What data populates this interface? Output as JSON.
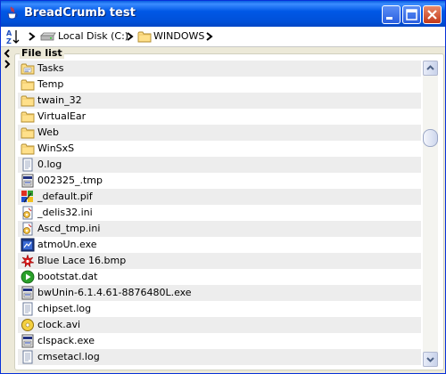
{
  "window": {
    "title": "BreadCrumb test"
  },
  "breadcrumb": {
    "items": [
      {
        "label": "Local Disk (C:)",
        "icon": "hard-drive-icon"
      },
      {
        "label": "WINDOWS",
        "icon": "folder-icon"
      }
    ]
  },
  "file_list": {
    "title": "File list",
    "items": [
      {
        "name": "Tasks",
        "icon": "tasks-folder-icon"
      },
      {
        "name": "Temp",
        "icon": "folder-icon"
      },
      {
        "name": "twain_32",
        "icon": "folder-icon"
      },
      {
        "name": "VirtualEar",
        "icon": "folder-icon"
      },
      {
        "name": "Web",
        "icon": "folder-icon"
      },
      {
        "name": "WinSxS",
        "icon": "folder-icon"
      },
      {
        "name": "0.log",
        "icon": "text-file-icon"
      },
      {
        "name": "002325_.tmp",
        "icon": "tmp-file-icon"
      },
      {
        "name": "_default.pif",
        "icon": "pif-file-icon"
      },
      {
        "name": "_delis32.ini",
        "icon": "ini-file-icon"
      },
      {
        "name": "Ascd_tmp.ini",
        "icon": "ini-file-icon"
      },
      {
        "name": "atmoUn.exe",
        "icon": "exe-file-icon"
      },
      {
        "name": "Blue Lace 16.bmp",
        "icon": "bmp-file-icon"
      },
      {
        "name": "bootstat.dat",
        "icon": "dat-file-icon"
      },
      {
        "name": "bwUnin-6.1.4.61-8876480L.exe",
        "icon": "tmp-file-icon"
      },
      {
        "name": "chipset.log",
        "icon": "text-file-icon"
      },
      {
        "name": "clock.avi",
        "icon": "avi-file-icon"
      },
      {
        "name": "clspack.exe",
        "icon": "tmp-file-icon"
      },
      {
        "name": "cmsetacl.log",
        "icon": "text-file-icon"
      }
    ]
  }
}
